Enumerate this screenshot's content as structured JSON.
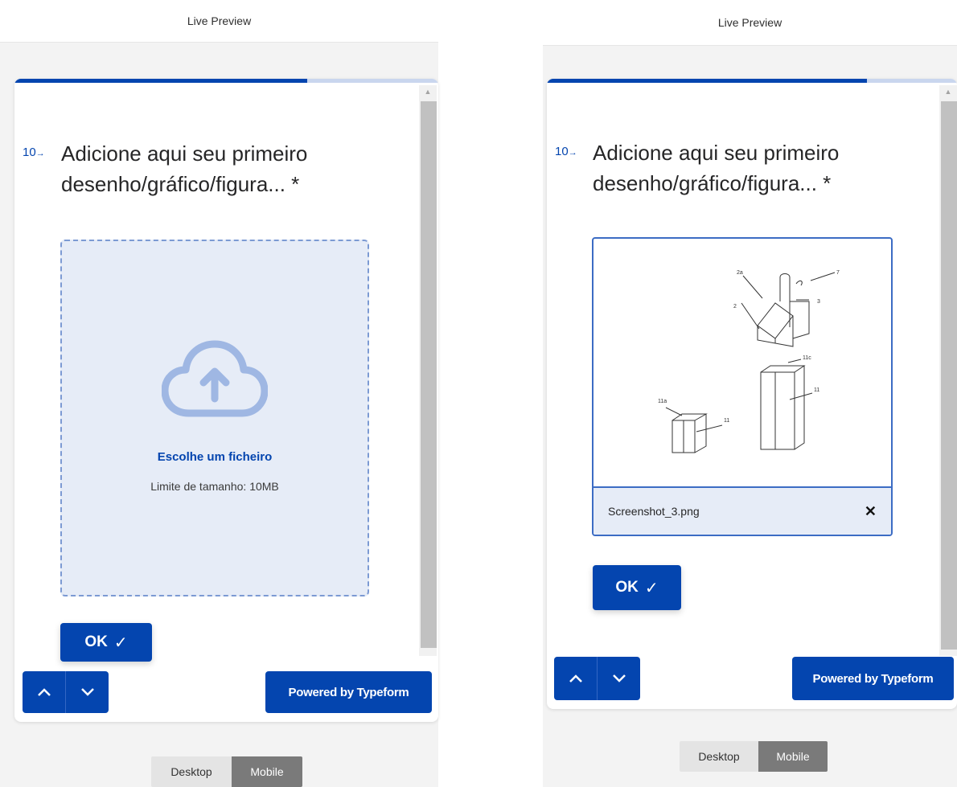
{
  "panels": [
    {
      "header": "Live Preview",
      "question": {
        "number": "10",
        "arrow": "→",
        "text": "Adicione aqui seu primeiro desenho/gráfico/figura... *"
      },
      "upload": {
        "choose_label": "Escolhe um ficheiro",
        "size_limit": "Limite de tamanho: 10MB"
      },
      "ok": {
        "label": "OK",
        "check": "✓"
      },
      "powered": "Powered by Typeform",
      "toggle": {
        "desktop": "Desktop",
        "mobile": "Mobile",
        "selected": "Mobile"
      },
      "progress": 0.69
    },
    {
      "header": "Live Preview",
      "question": {
        "number": "10",
        "arrow": "→",
        "text": "Adicione aqui seu primeiro desenho/gráfico/figura... *"
      },
      "file": {
        "name": "Screenshot_3.png",
        "remove": "✕",
        "drawing_labels": [
          "2a",
          "7",
          "2",
          "3",
          "11c",
          "11",
          "11a",
          "11"
        ]
      },
      "ok": {
        "label": "OK",
        "check": "✓"
      },
      "powered": "Powered by Typeform",
      "toggle": {
        "desktop": "Desktop",
        "mobile": "Mobile",
        "selected": "Mobile"
      },
      "progress": 0.8
    }
  ],
  "colors": {
    "accent": "#0445af",
    "dropzone_bg": "#e6ecf7",
    "track": "#c9d6ee"
  },
  "icons": [
    "cloud-upload-icon",
    "chevron-up-icon",
    "chevron-down-icon",
    "close-icon",
    "check-icon"
  ]
}
